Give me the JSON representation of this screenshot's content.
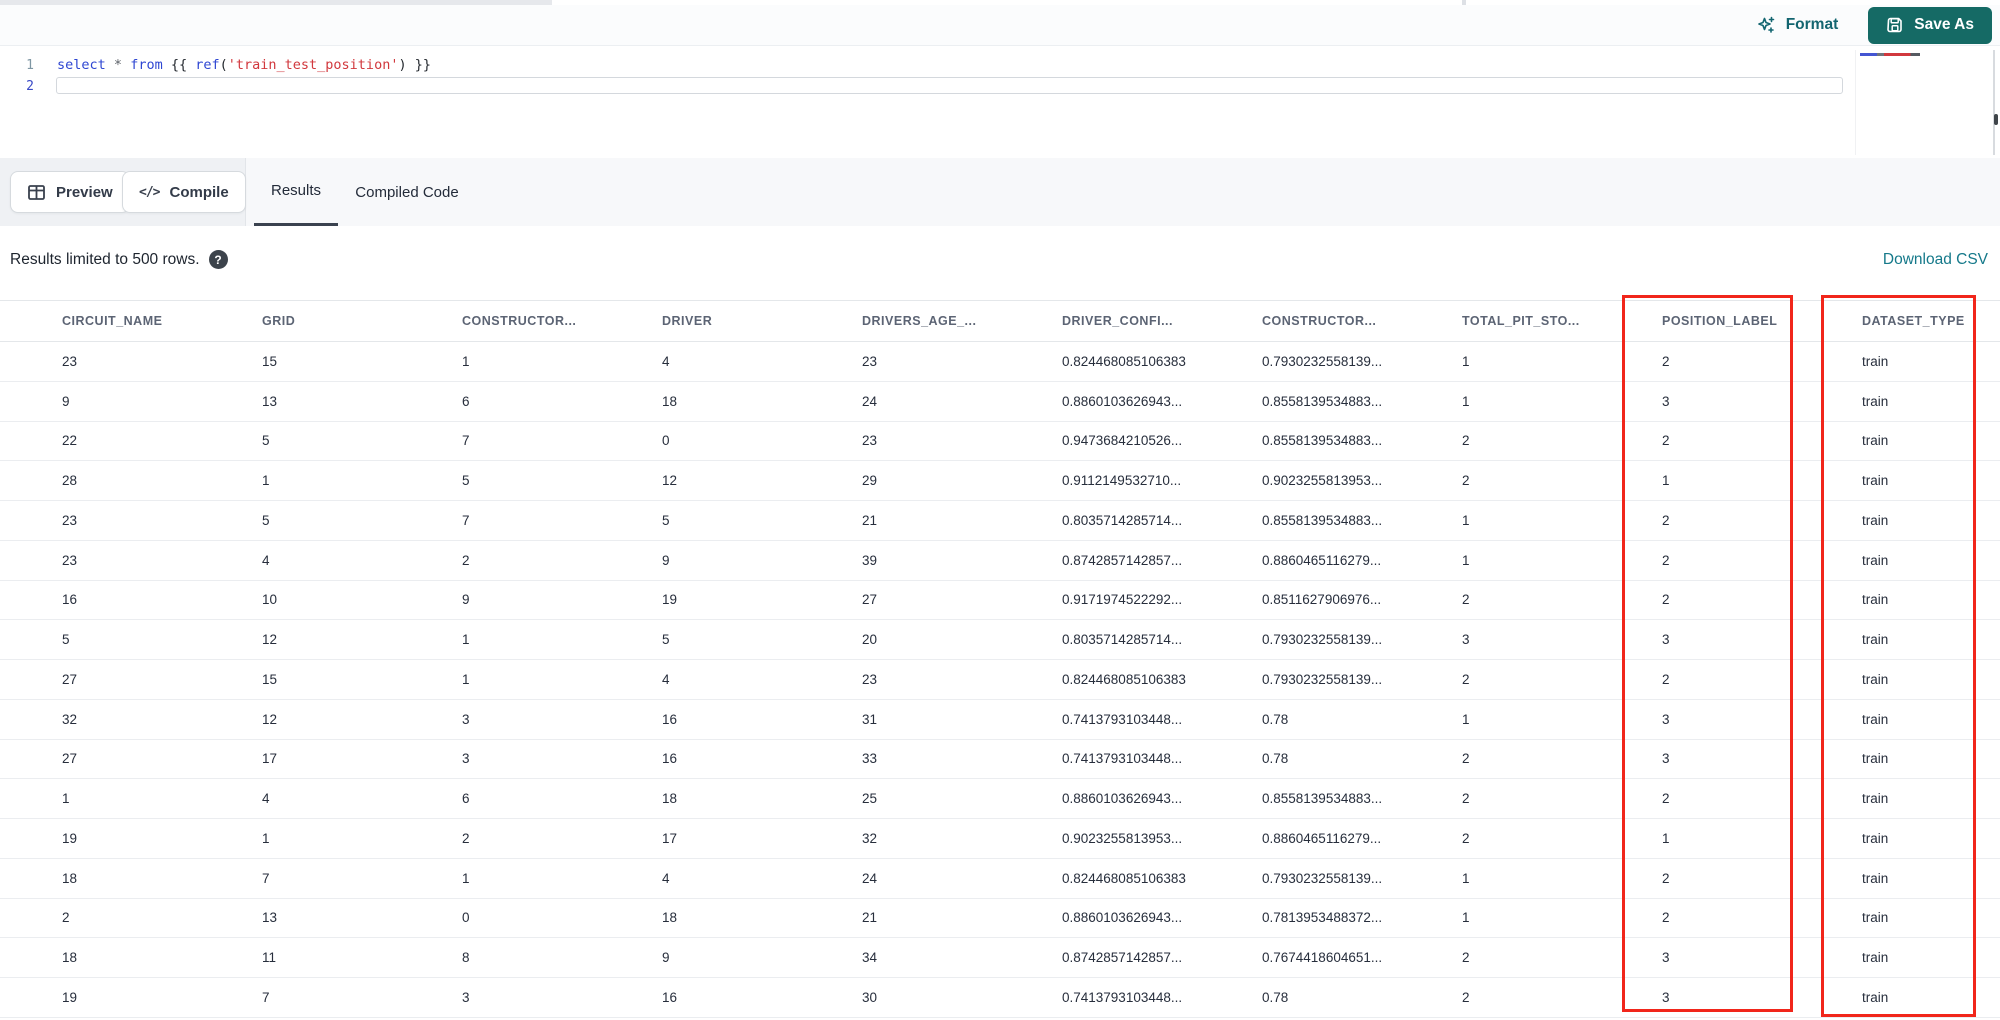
{
  "toolbar": {
    "format_label": "Format",
    "save_as_label": "Save As"
  },
  "editor": {
    "line1_number": "1",
    "line2_number": "2",
    "code_tokens": [
      {
        "text": "select",
        "cls": "kw"
      },
      {
        "text": " ",
        "cls": "plain"
      },
      {
        "text": "*",
        "cls": "op"
      },
      {
        "text": " ",
        "cls": "plain"
      },
      {
        "text": "from",
        "cls": "kw"
      },
      {
        "text": " {{ ",
        "cls": "brace"
      },
      {
        "text": "ref",
        "cls": "fn"
      },
      {
        "text": "(",
        "cls": "plain"
      },
      {
        "text": "'train_test_position'",
        "cls": "str"
      },
      {
        "text": ")",
        "cls": "plain"
      },
      {
        "text": " }}",
        "cls": "brace"
      }
    ]
  },
  "actions": {
    "preview_label": "Preview",
    "compile_label": "Compile"
  },
  "tabs": [
    {
      "label": "Results",
      "active": true
    },
    {
      "label": "Compiled Code",
      "active": false
    }
  ],
  "results": {
    "limit_note": "Results limited to 500 rows.",
    "download_label": "Download CSV"
  },
  "icons": {
    "compile_glyph": "</>",
    "help_glyph": "?"
  },
  "table": {
    "columns": [
      "CIRCUIT_NAME",
      "GRID",
      "CONSTRUCTOR...",
      "DRIVER",
      "DRIVERS_AGE_...",
      "DRIVER_CONFI...",
      "CONSTRUCTOR...",
      "TOTAL_PIT_STO...",
      "POSITION_LABEL",
      "DATASET_TYPE"
    ],
    "rows": [
      [
        "23",
        "15",
        "1",
        "4",
        "23",
        "0.824468085106383",
        "0.7930232558139...",
        "1",
        "2",
        "train"
      ],
      [
        "9",
        "13",
        "6",
        "18",
        "24",
        "0.8860103626943...",
        "0.8558139534883...",
        "1",
        "3",
        "train"
      ],
      [
        "22",
        "5",
        "7",
        "0",
        "23",
        "0.9473684210526...",
        "0.8558139534883...",
        "2",
        "2",
        "train"
      ],
      [
        "28",
        "1",
        "5",
        "12",
        "29",
        "0.9112149532710...",
        "0.9023255813953...",
        "2",
        "1",
        "train"
      ],
      [
        "23",
        "5",
        "7",
        "5",
        "21",
        "0.8035714285714...",
        "0.8558139534883...",
        "1",
        "2",
        "train"
      ],
      [
        "23",
        "4",
        "2",
        "9",
        "39",
        "0.8742857142857...",
        "0.8860465116279...",
        "1",
        "2",
        "train"
      ],
      [
        "16",
        "10",
        "9",
        "19",
        "27",
        "0.9171974522292...",
        "0.8511627906976...",
        "2",
        "2",
        "train"
      ],
      [
        "5",
        "12",
        "1",
        "5",
        "20",
        "0.8035714285714...",
        "0.7930232558139...",
        "3",
        "3",
        "train"
      ],
      [
        "27",
        "15",
        "1",
        "4",
        "23",
        "0.824468085106383",
        "0.7930232558139...",
        "2",
        "2",
        "train"
      ],
      [
        "32",
        "12",
        "3",
        "16",
        "31",
        "0.7413793103448...",
        "0.78",
        "1",
        "3",
        "train"
      ],
      [
        "27",
        "17",
        "3",
        "16",
        "33",
        "0.7413793103448...",
        "0.78",
        "2",
        "3",
        "train"
      ],
      [
        "1",
        "4",
        "6",
        "18",
        "25",
        "0.8860103626943...",
        "0.8558139534883...",
        "2",
        "2",
        "train"
      ],
      [
        "19",
        "1",
        "2",
        "17",
        "32",
        "0.9023255813953...",
        "0.8860465116279...",
        "2",
        "1",
        "train"
      ],
      [
        "18",
        "7",
        "1",
        "4",
        "24",
        "0.824468085106383",
        "0.7930232558139...",
        "1",
        "2",
        "train"
      ],
      [
        "2",
        "13",
        "0",
        "18",
        "21",
        "0.8860103626943...",
        "0.7813953488372...",
        "1",
        "2",
        "train"
      ],
      [
        "18",
        "11",
        "8",
        "9",
        "34",
        "0.8742857142857...",
        "0.7674418604651...",
        "2",
        "3",
        "train"
      ],
      [
        "19",
        "7",
        "3",
        "16",
        "30",
        "0.7413793103448...",
        "0.78",
        "2",
        "3",
        "train"
      ]
    ]
  },
  "annotations": {
    "highlight_color": "#f1261b",
    "highlighted_columns": [
      "POSITION_LABEL",
      "DATASET_TYPE"
    ]
  },
  "colors": {
    "accent_teal": "#136570",
    "save_button_bg": "#156a65",
    "link_teal": "#15798a",
    "header_text": "#5c6474",
    "cell_text": "#272e3c"
  }
}
